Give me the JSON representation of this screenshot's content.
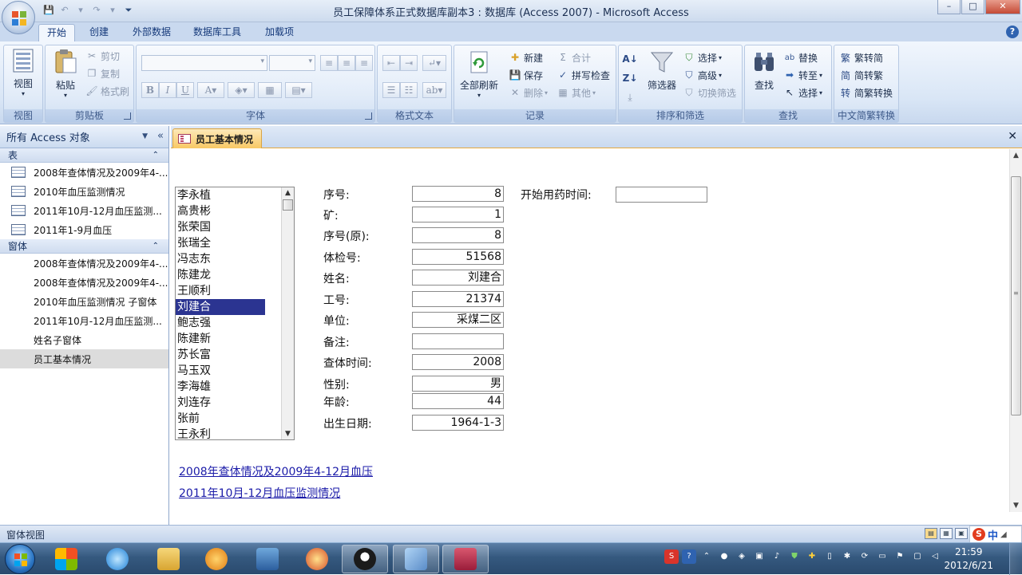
{
  "window": {
    "title": "员工保障体系正式数据库副本3 : 数据库 (Access 2007) - Microsoft Access",
    "controls": [
      "–",
      "□",
      "✕"
    ]
  },
  "ribbon": {
    "tabs": [
      "开始",
      "创建",
      "外部数据",
      "数据库工具",
      "加载项"
    ],
    "active_tab": "开始",
    "groups": {
      "view": {
        "label": "视图",
        "button": "视图"
      },
      "clipboard": {
        "label": "剪贴板",
        "paste": "粘贴",
        "cut": "剪切",
        "copy": "复制",
        "format_painter": "格式刷"
      },
      "font": {
        "label": "字体"
      },
      "rich_text": {
        "label": "格式文本"
      },
      "records": {
        "label": "记录",
        "refresh_all": "全部刷新",
        "new": "新建",
        "save": "保存",
        "delete": "删除",
        "totals": "合计",
        "spelling": "拼写检查",
        "more": "其他"
      },
      "sort_filter": {
        "label": "排序和筛选",
        "filter": "筛选器",
        "selection": "选择",
        "advanced": "高级",
        "toggle_filter": "切换筛选"
      },
      "find": {
        "label": "查找",
        "find": "查找",
        "replace": "替换",
        "goto": "转至",
        "select": "选择"
      },
      "chinese_conversion": {
        "label": "中文简繁转换",
        "trad_to_simp": "繁转简",
        "simp_to_trad": "简转繁",
        "convert": "简繁转换"
      }
    }
  },
  "nav_pane": {
    "header": "所有 Access 对象",
    "sections": [
      {
        "title": "表",
        "items": [
          "2008年查体情况及2009年4-...",
          "2010年血压监测情况",
          "2011年10月-12月血压监测...",
          "2011年1-9月血压"
        ]
      },
      {
        "title": "窗体",
        "items": [
          "2008年查体情况及2009年4-...",
          "2008年查体情况及2009年4-...",
          "2010年血压监测情况 子窗体",
          "2011年10月-12月血压监测...",
          "姓名子窗体",
          "员工基本情况"
        ]
      }
    ],
    "selected_item": "员工基本情况"
  },
  "document": {
    "tab_title": "员工基本情况",
    "listbox": {
      "items": [
        "李永植",
        "高贵彬",
        "张荣国",
        "张瑞全",
        "冯志东",
        "陈建龙",
        "王顺利",
        "刘建合",
        "鲍志强",
        "陈建新",
        "苏长富",
        "马玉双",
        "李海雄",
        "刘连存",
        "张前",
        "王永利"
      ],
      "selected": "刘建合"
    },
    "fields": {
      "seq": {
        "label": "序号:",
        "value": "8"
      },
      "mine": {
        "label": "矿:",
        "value": "1"
      },
      "seq_orig": {
        "label": "序号(原):",
        "value": "8"
      },
      "exam_no": {
        "label": "体检号:",
        "value": "51568"
      },
      "name": {
        "label": "姓名:",
        "value": "刘建合"
      },
      "emp_no": {
        "label": "工号:",
        "value": "21374"
      },
      "unit": {
        "label": "单位:",
        "value": "采煤二区"
      },
      "note": {
        "label": "备注:",
        "value": ""
      },
      "exam_time": {
        "label": "查体时间:",
        "value": "2008"
      },
      "gender": {
        "label": "性别:",
        "value": "男"
      },
      "age": {
        "label": "年龄:",
        "value": "44"
      },
      "birth": {
        "label": "出生日期:",
        "value": "1964-1-3"
      },
      "med_start": {
        "label": "开始用药时间:",
        "value": ""
      }
    },
    "links": [
      "2008年查体情况及2009年4-12月血压",
      "2011年10月-12月血压监测情况"
    ]
  },
  "status_bar": {
    "text": "窗体视图",
    "ime": "中"
  },
  "taskbar": {
    "time": "21:59",
    "date": "2012/6/21"
  }
}
